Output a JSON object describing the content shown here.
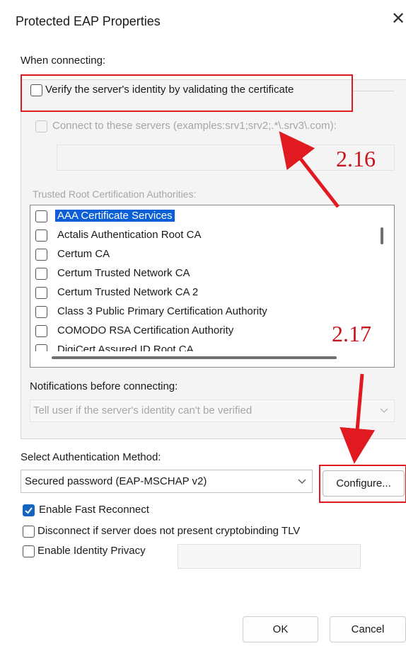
{
  "window": {
    "title": "Protected EAP Properties",
    "close_glyph": "✕"
  },
  "when_connecting": {
    "label": "When connecting:",
    "verify_cert": {
      "label": "Verify the server's identity by validating the certificate",
      "checked": false
    },
    "connect_servers": {
      "label": "Connect to these servers (examples:srv1;srv2;.*\\.srv3\\.com):",
      "checked": false,
      "enabled": false
    },
    "servers_value": ""
  },
  "trusted_ca": {
    "label": "Trusted Root Certification Authorities:",
    "items": [
      {
        "label": "AAA Certificate Services",
        "selected": true
      },
      {
        "label": "Actalis Authentication Root CA"
      },
      {
        "label": "Certum CA"
      },
      {
        "label": "Certum Trusted Network CA"
      },
      {
        "label": "Certum Trusted Network CA 2"
      },
      {
        "label": "Class 3 Public Primary Certification Authority"
      },
      {
        "label": "COMODO RSA Certification Authority"
      },
      {
        "label": "DigiCert Assured ID Root CA"
      }
    ]
  },
  "notifications": {
    "label": "Notifications before connecting:",
    "value": "Tell user if the server's identity can't be verified"
  },
  "auth_method": {
    "label": "Select Authentication Method:",
    "value": "Secured password (EAP-MSCHAP v2)",
    "configure_label": "Configure..."
  },
  "options": {
    "fast_reconnect": {
      "label": "Enable Fast Reconnect",
      "checked": true
    },
    "cryptobinding": {
      "label": "Disconnect if server does not present cryptobinding TLV",
      "checked": false
    },
    "identity_privacy": {
      "label": "Enable Identity Privacy",
      "checked": false
    },
    "privacy_value": ""
  },
  "buttons": {
    "ok": "OK",
    "cancel": "Cancel"
  },
  "annotations": {
    "step1": "2.16",
    "step2": "2.17",
    "color": "#e11a22"
  },
  "colors": {
    "accent": "#1565c0",
    "selection": "#0b5fd6",
    "disabled_text": "#a6a6a6"
  }
}
